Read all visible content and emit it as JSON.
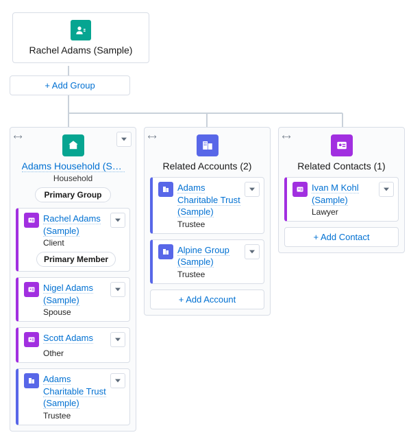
{
  "root": {
    "title": "Rachel Adams (Sample)"
  },
  "add_group_label": "+ Add Group",
  "columns": {
    "household": {
      "title": "Adams Household (Sam…",
      "subtitle": "Household",
      "primary_chip": "Primary Group",
      "members": [
        {
          "name": "Rachel Adams (Sample)",
          "role": "Client",
          "accent": "purple",
          "primary_member": true
        },
        {
          "name": "Nigel Adams (Sample)",
          "role": "Spouse",
          "accent": "purple"
        },
        {
          "name": "Scott Adams",
          "role": "Other",
          "accent": "purple"
        },
        {
          "name": "Adams Charitable Trust (Sample)",
          "role": "Trustee",
          "accent": "blue"
        }
      ],
      "primary_member_chip": "Primary Member"
    },
    "accounts": {
      "title": "Related Accounts (2)",
      "items": [
        {
          "name": "Adams Charitable Trust (Sample)",
          "role": "Trustee"
        },
        {
          "name": "Alpine Group (Sample)",
          "role": "Trustee"
        }
      ],
      "add_label": "+ Add Account"
    },
    "contacts": {
      "title": "Related Contacts (1)",
      "items": [
        {
          "name": "Ivan M Kohl (Sample)",
          "role": "Lawyer"
        }
      ],
      "add_label": "+ Add Contact"
    }
  }
}
